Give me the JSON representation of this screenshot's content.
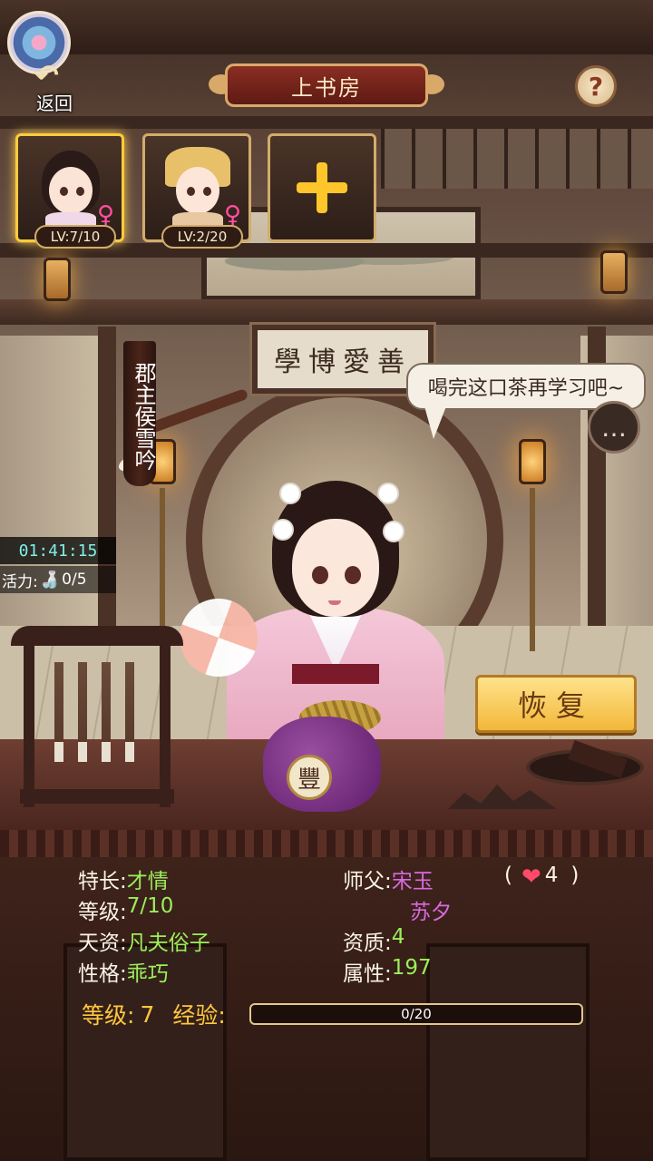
{
  "header": {
    "title": "上书房",
    "back_label": "返回",
    "help_symbol": "?"
  },
  "slots": [
    {
      "level": "LV:7/10",
      "gender": "♀",
      "selected": true
    },
    {
      "level": "LV:2/20",
      "gender": "♀",
      "selected": false
    }
  ],
  "add_slot_icon": "plus-icon",
  "scene": {
    "plaque_text": "學博愛善",
    "character_name": "郡主侯雪吟",
    "bag_char": "豐",
    "speech": "喝完这口茶再学习吧~"
  },
  "timer": "01:41:15",
  "vitality": {
    "label": "活力:",
    "value": "0/5"
  },
  "restore_button": "恢复",
  "info": {
    "specialty": {
      "label": "特长:",
      "value": "才情"
    },
    "level": {
      "label": "等级:",
      "value": "7/10"
    },
    "talent": {
      "label": "天资:",
      "value": "凡夫俗子"
    },
    "personality": {
      "label": "性格:",
      "value": "乖巧"
    },
    "teacher": {
      "label": "师父:",
      "names": [
        "宋玉",
        "苏夕"
      ],
      "open_paren": "(",
      "affection": "4",
      "close_paren": ")"
    },
    "aptitude": {
      "label": "资质:",
      "value": "4"
    },
    "attribute": {
      "label": "属性:",
      "value": "197"
    }
  },
  "progress": {
    "level_label": "等级:",
    "level_value": "7",
    "exp_label": "经验:",
    "exp_text": "0/20",
    "exp_fraction": 0
  },
  "colors": {
    "accent_gold": "#ffc840",
    "value_green": "#9bef5a",
    "teacher_purple": "#d86ae0"
  }
}
